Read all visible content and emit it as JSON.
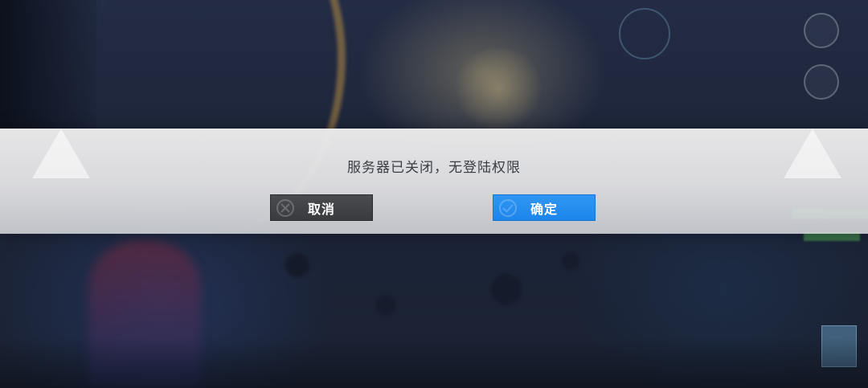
{
  "dialog": {
    "message": "服务器已关闭，无登陆权限",
    "cancel_label": "取消",
    "confirm_label": "确定"
  },
  "background": {
    "icons": [
      "settings-icon",
      "rank-icon"
    ]
  },
  "colors": {
    "dialog_bg": "#e6e6e8",
    "cancel_bg": "#424347",
    "confirm_bg": "#2690f0",
    "message_text": "#3a3d44"
  }
}
